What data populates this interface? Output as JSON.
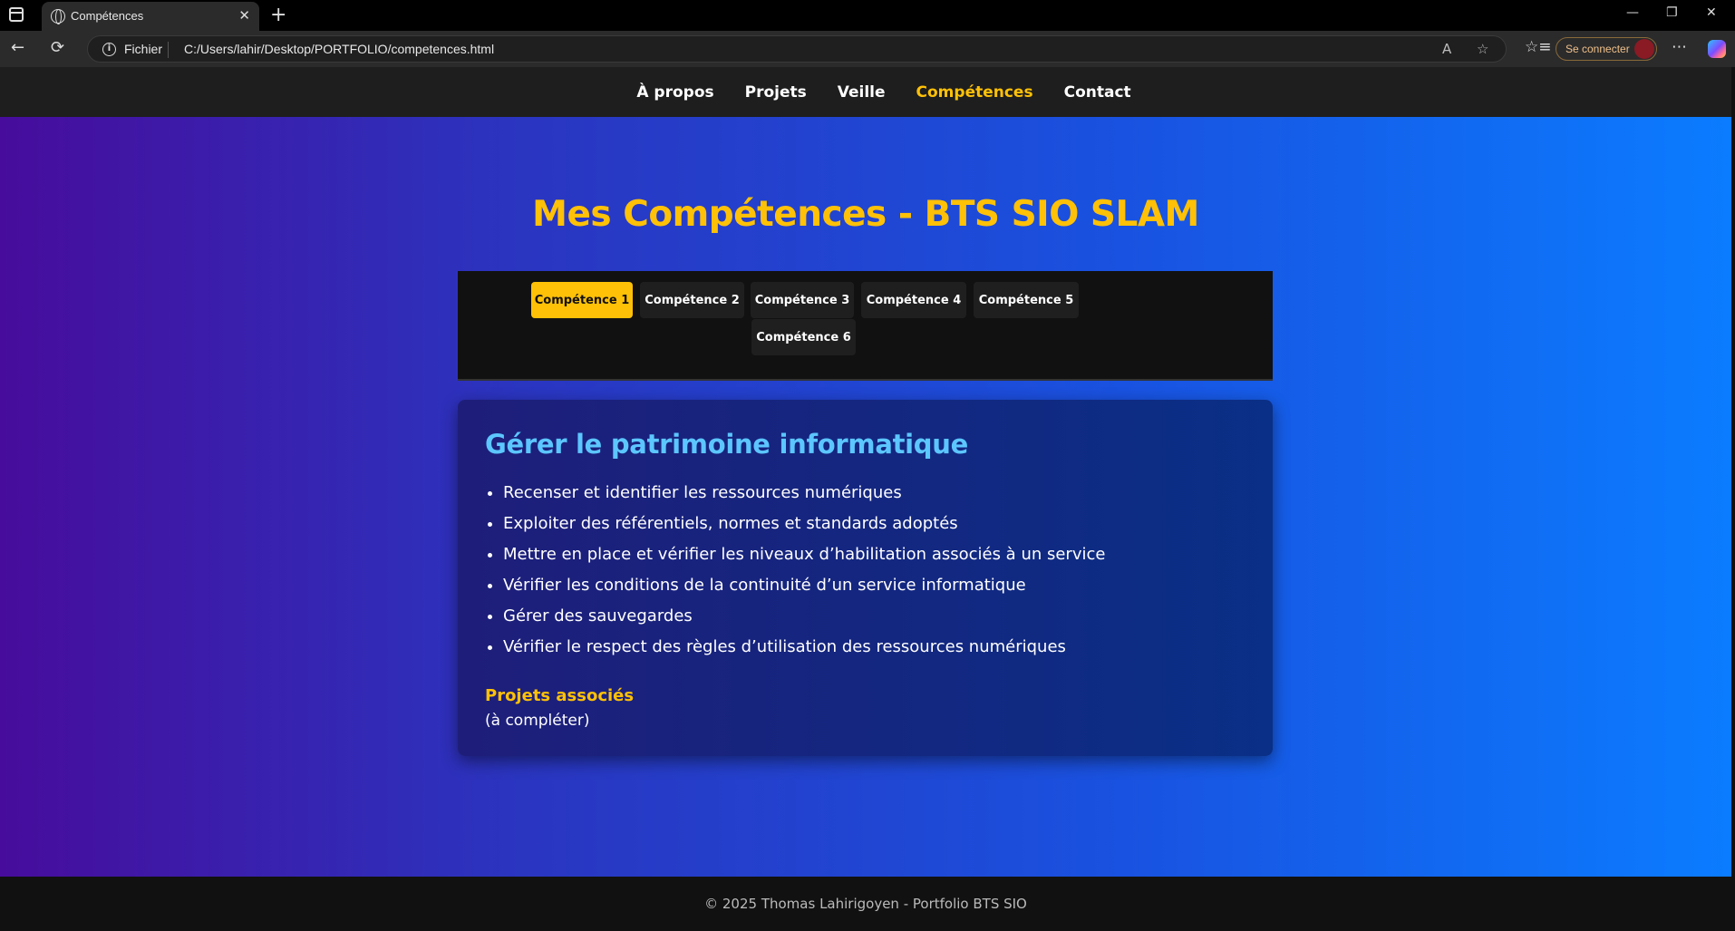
{
  "browser": {
    "tab_title": "Compétences",
    "tab_close": "✕",
    "new_tab": "+",
    "controls": {
      "minimize": "—",
      "restore": "❐",
      "close": "✕"
    },
    "nav": {
      "back": "←",
      "refresh": "⟳"
    },
    "address": {
      "scheme_label": "Fichier",
      "url": "C:/Users/lahir/Desktop/PORTFOLIO/competences.html"
    },
    "icons": {
      "read_aloud": "A",
      "favorite": "☆",
      "favorites_list": "☆≡",
      "more": "⋯"
    },
    "signin_label": "Se connecter"
  },
  "site": {
    "nav": [
      "À propos",
      "Projets",
      "Veille",
      "Compétences",
      "Contact"
    ],
    "active_nav": "Compétences",
    "heading": "Mes Compétences - BTS SIO SLAM",
    "tabs": [
      "Compétence 1",
      "Compétence 2",
      "Compétence 3",
      "Compétence 4",
      "Compétence 5",
      "Compétence 6"
    ],
    "active_tab": "Compétence 1",
    "card": {
      "title": "Gérer le patrimoine informatique",
      "items": [
        "Recenser et identifier les ressources numériques",
        "Exploiter des référentiels, normes et standards adoptés",
        "Mettre en place et vérifier les niveaux d’habilitation associés à un service",
        "Vérifier les conditions de la continuité d’un service informatique",
        "Gérer des sauvegardes",
        "Vérifier le respect des règles d’utilisation des ressources numériques"
      ],
      "projects_title": "Projets associés",
      "projects_text": "(à compléter)"
    },
    "footer": "© 2025 Thomas Lahirigoyen - Portfolio BTS SIO"
  },
  "colors": {
    "accent": "#ffc107",
    "card_title": "#5cc6ff",
    "nav_bg": "#1e1e1e",
    "gradient_start": "#470c9c",
    "gradient_end": "#0b7cff"
  }
}
